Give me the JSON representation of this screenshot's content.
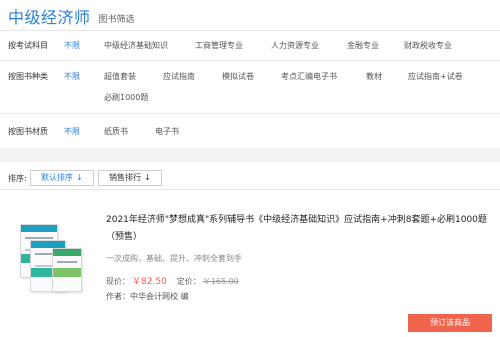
{
  "header": {
    "title": "中级经济师",
    "subtitle": "图书筛选"
  },
  "filters": [
    {
      "label": "按考试科目",
      "options": [
        "不限",
        "中级经济基础知识",
        "工商管理专业",
        "人力资源专业",
        "金融专业",
        "财政税收专业"
      ]
    },
    {
      "label": "按图书种类",
      "options": [
        "不限",
        "超值套装",
        "应试指南",
        "模拟试卷",
        "考点汇编电子书",
        "教材",
        "应试指南+试卷",
        "必刷1000题"
      ]
    },
    {
      "label": "按图书材质",
      "options": [
        "不限",
        "纸质书",
        "电子书"
      ]
    }
  ],
  "sort": {
    "label": "排序:",
    "default_label": "默认排序",
    "sales_label": "销售排行",
    "arrow": "↓"
  },
  "product": {
    "title": "2021年经济师\"梦想成真\"系列辅导书《中级经济基础知识》应试指南+冲刺8套题+必刷1000题（预售）",
    "desc": "一次成购，基础、提升、冲刺全套到手",
    "price_label": "现价：",
    "price": "￥82.50",
    "orig_label": "定价：",
    "orig_price": "￥165.00",
    "author_label": "作者：",
    "author": "中华会计网校 编",
    "order_button": "预订该商品"
  },
  "colors": {
    "accent": "#2a7fd8",
    "order": "#f0644e",
    "price": "#f0604a"
  }
}
